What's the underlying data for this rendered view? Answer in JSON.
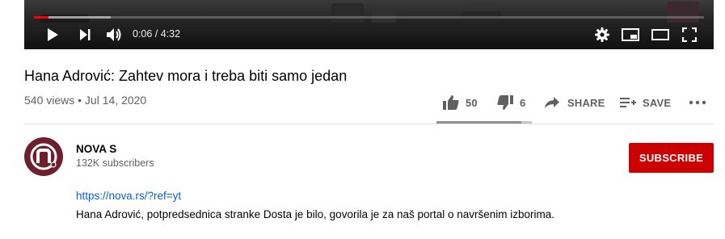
{
  "player": {
    "current_time": "0:06",
    "duration": "4:32",
    "time_display": "0:06 / 4:32",
    "progress_played": 0.022,
    "progress_loaded": 0.115,
    "controls": [
      "play-icon",
      "next-icon",
      "volume-icon",
      "settings-icon",
      "miniplayer-icon",
      "theater-icon",
      "fullscreen-icon"
    ]
  },
  "video": {
    "title": "Hana Adrović: Zahtev mora i treba biti samo jedan",
    "meta": "540 views • Jul 14, 2020"
  },
  "actions": {
    "likes": "50",
    "dislikes": "6",
    "share_label": "SHARE",
    "save_label": "SAVE",
    "like_ratio": 0.89
  },
  "channel": {
    "name": "NOVA S",
    "subscribers": "132K subscribers",
    "subscribe_label": "SUBSCRIBE"
  },
  "description": {
    "link": "https://nova.rs/?ref=yt",
    "text": "Hana Adrović, potpredsednica stranke Dosta je bilo, govorila je za naš portal o navršenim izborima."
  },
  "colors": {
    "accent_red": "#cc0000",
    "progress_red": "#ff0000",
    "link_blue": "#065fd4",
    "avatar_bg": "#6d1f2e"
  }
}
